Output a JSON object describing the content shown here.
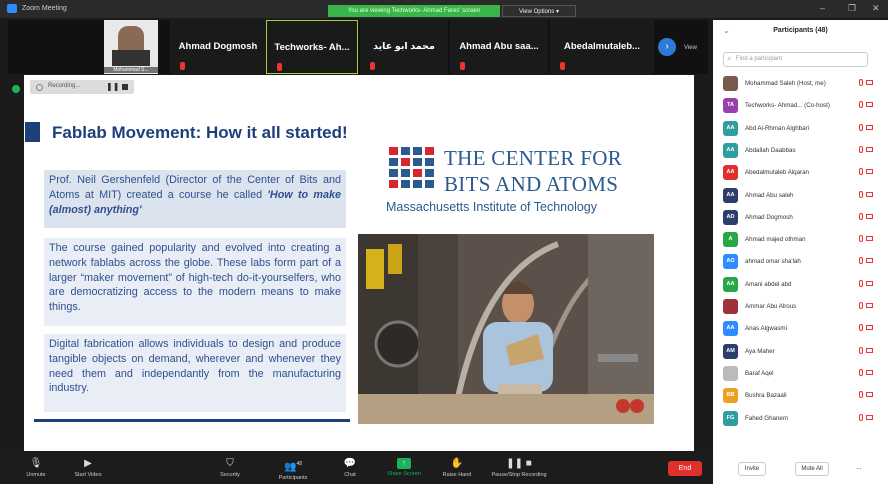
{
  "window": {
    "title": "Zoom Meeting",
    "share_banner": "You are viewing Techworks- Ahmad Fares' screen",
    "view_options": "View Options ▾"
  },
  "strip": {
    "video_tile_caption": "Mohammad S...",
    "tiles": [
      "Ahmad Dogmosh",
      "Techworks- Ah...",
      "محمد ابو عايد",
      "Ahmad Abu saa...",
      "Abedalmutaleb..."
    ],
    "view_label": "View"
  },
  "recording": {
    "label": "Recording..."
  },
  "slide": {
    "title": "Fablab Movement: How it all started!",
    "p1_text": "Prof. Neil Gershenfeld (Director of the Center of Bits and Atoms at MIT) created a course he called ",
    "p1_course": "'How to make (almost) anything'",
    "p2": "The course gained popularity and evolved into creating a network fablabs across the globe. These labs form part of a larger “maker movement” of high-tech do-it-yourselfers, who are democratizing access to the modern means to make things.",
    "p3": "Digital fabrication allows individuals to design and produce tangible objects on demand, wherever and whenever they need them and independantly from the manufacturing industry.",
    "logo_line1": "THE CENTER FOR",
    "logo_line2": "BITS AND ATOMS",
    "logo_line3": "Massachusetts Institute of Technology"
  },
  "participants": {
    "title": "Participants (48)",
    "search_placeholder": "Find a participant",
    "list": [
      {
        "initials": "",
        "name": "Mohammad Saleh (Host, me)",
        "color": "#7a5a4a"
      },
      {
        "initials": "TA",
        "name": "Techworks- Ahmad... (Co-host)",
        "color": "#9b3fae"
      },
      {
        "initials": "AA",
        "name": "Abd Al-Rhman Alghbari",
        "color": "#2f9e9e"
      },
      {
        "initials": "AA",
        "name": "Abdallah Daabbas",
        "color": "#2f9e9e"
      },
      {
        "initials": "AA",
        "name": "Abedalmutaleb Alqaran",
        "color": "#e0302b"
      },
      {
        "initials": "AA",
        "name": "Ahmad Abu saleh",
        "color": "#2c3e6b"
      },
      {
        "initials": "AD",
        "name": "Ahmad Dogmosh",
        "color": "#2c3e6b"
      },
      {
        "initials": "A",
        "name": "Ahmad majed othman",
        "color": "#28a745"
      },
      {
        "initials": "AO",
        "name": "ahmad omar sha'lah",
        "color": "#2d8cff"
      },
      {
        "initials": "AA",
        "name": "Amani abdel abd",
        "color": "#28a745"
      },
      {
        "initials": "",
        "name": "Ammar Abu Alrous",
        "color": "#a0303a"
      },
      {
        "initials": "AA",
        "name": "Anas Algwasmi",
        "color": "#2d8cff"
      },
      {
        "initials": "AM",
        "name": "Aya Maher",
        "color": "#2c3e6b"
      },
      {
        "initials": "",
        "name": "Baraf Aqel",
        "color": "#bbbbbb"
      },
      {
        "initials": "BB",
        "name": "Bushra Bazaali",
        "color": "#f0a020"
      },
      {
        "initials": "FG",
        "name": "Fahed Ghanem",
        "color": "#2f9e9e"
      }
    ],
    "invite": "Invite",
    "mute_all": "Mute All",
    "more": "..."
  },
  "toolbar": {
    "unmute": "Unmute",
    "start_video": "Start Video",
    "security": "Security",
    "participants": "Participants",
    "participants_count": "48",
    "chat": "Chat",
    "share_screen": "Share Screen",
    "raise_hand": "Raise Hand",
    "pause_recording": "Pause/Stop Recording",
    "end": "End"
  },
  "colors": {
    "accent": "#2d8cff",
    "slide_blue": "#1e3f7a",
    "end_red": "#e0302b",
    "share_green": "#1fb15a"
  }
}
